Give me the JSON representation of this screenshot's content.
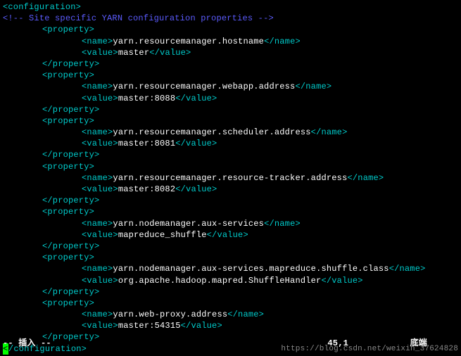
{
  "root_tag": "configuration",
  "comment": " Site specific YARN configuration properties ",
  "properties": [
    {
      "name": "yarn.resourcemanager.hostname",
      "value": "master"
    },
    {
      "name": "yarn.resourcemanager.webapp.address",
      "value": "master:8088"
    },
    {
      "name": "yarn.resourcemanager.scheduler.address",
      "value": "master:8081"
    },
    {
      "name": "yarn.resourcemanager.resource-tracker.address",
      "value": "master:8082"
    },
    {
      "name": "yarn.nodemanager.aux-services",
      "value": "mapreduce_shuffle"
    },
    {
      "name": "yarn.nodemanager.aux-services.mapreduce.shuffle.class",
      "value": "org.apache.hadoop.mapred.ShuffleHandler"
    },
    {
      "name": "yarn.web-proxy.address",
      "value": "master:54315"
    }
  ],
  "status": {
    "mode": "-- 插入 --",
    "position": "45,1",
    "scroll": "底端"
  },
  "watermark": "https://blog.csdn.net/weixin_37624828"
}
